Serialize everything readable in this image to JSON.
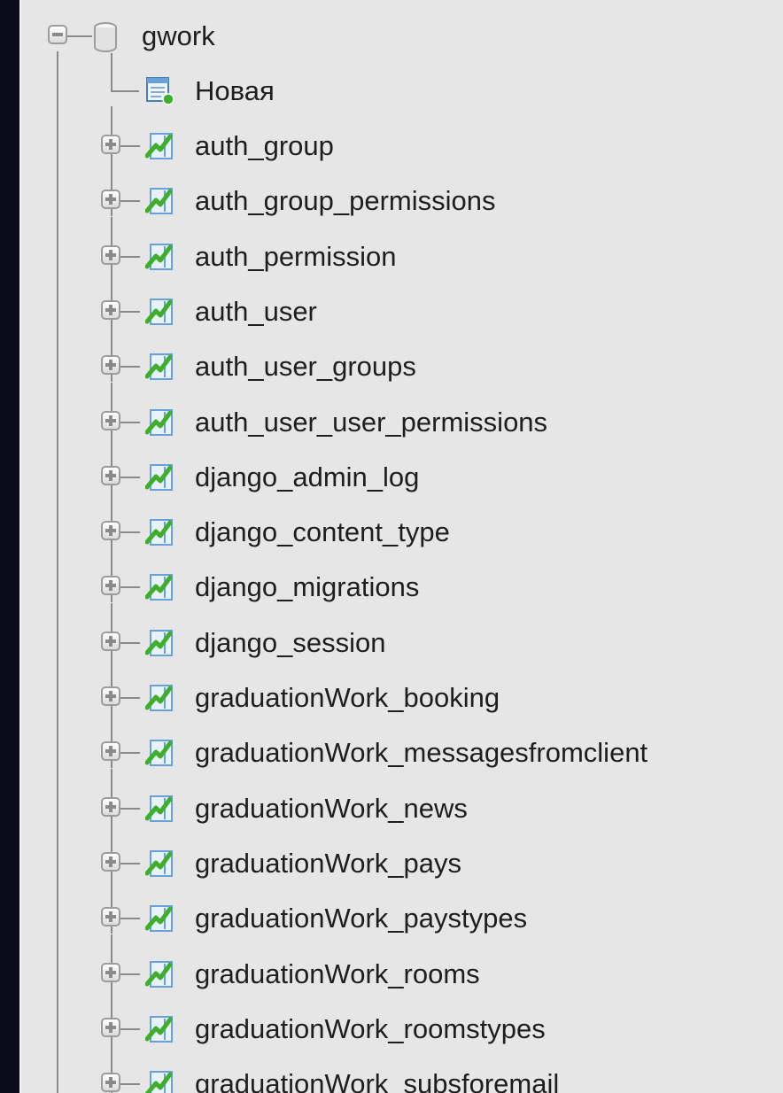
{
  "tree": {
    "root": {
      "label": "gwork",
      "icon": "database-icon",
      "expanded": true
    },
    "new_item": {
      "label": "Новая",
      "icon": "new-table-icon"
    },
    "tables": [
      "auth_group",
      "auth_group_permissions",
      "auth_permission",
      "auth_user",
      "auth_user_groups",
      "auth_user_user_permissions",
      "django_admin_log",
      "django_content_type",
      "django_migrations",
      "django_session",
      "graduationWork_booking",
      "graduationWork_messagesfromclient",
      "graduationWork_news",
      "graduationWork_pays",
      "graduationWork_paystypes",
      "graduationWork_rooms",
      "graduationWork_roomstypes",
      "graduationWork_subsforemail"
    ]
  },
  "colors": {
    "background": "#0b0b1c",
    "panel": "#e6e6e6",
    "icon_green": "#3fae2a",
    "icon_blue": "#2f7fc4"
  }
}
